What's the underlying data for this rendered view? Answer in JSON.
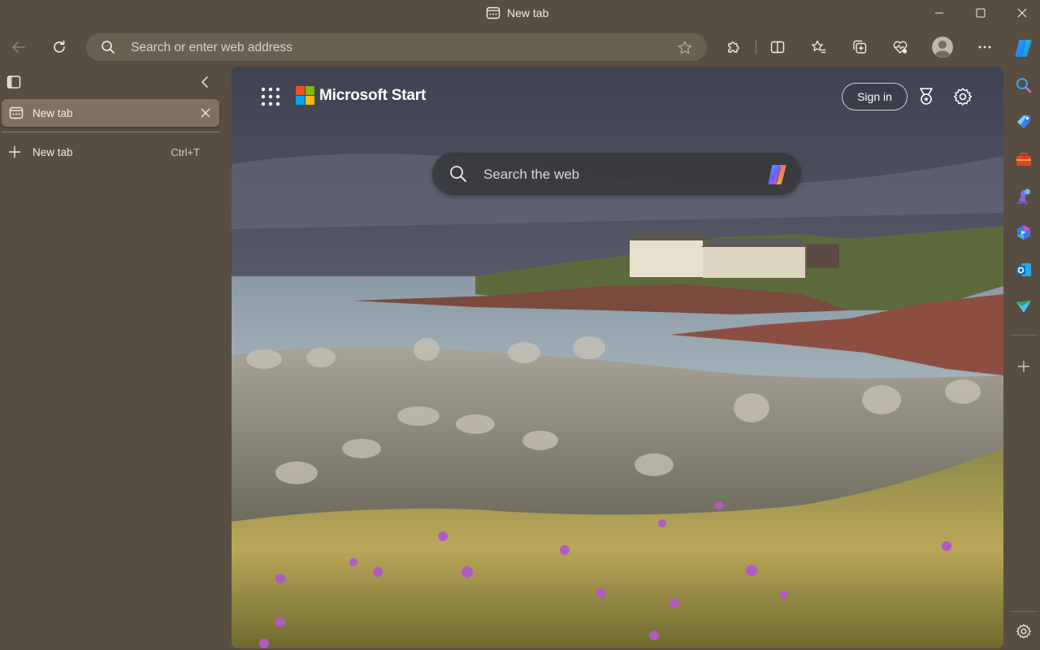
{
  "window": {
    "title": "New tab"
  },
  "toolbar": {
    "address_placeholder": "Search or enter web address"
  },
  "tabs": {
    "active_tab_title": "New tab",
    "new_tab_label": "New tab",
    "new_tab_shortcut": "Ctrl+T"
  },
  "page": {
    "brand": "Microsoft Start",
    "sign_in_label": "Sign in",
    "search_placeholder": "Search the web"
  },
  "sidebar_icons": [
    "copilot-icon",
    "search-icon",
    "shopping-tag-icon",
    "tools-icon",
    "games-icon",
    "microsoft-365-icon",
    "outlook-icon",
    "send-icon",
    "add-icon",
    "settings-icon"
  ],
  "colors": {
    "frame": "#574d40",
    "ms_red": "#f25022",
    "ms_green": "#7fba00",
    "ms_blue": "#00a4ef",
    "ms_yellow": "#ffb900"
  }
}
